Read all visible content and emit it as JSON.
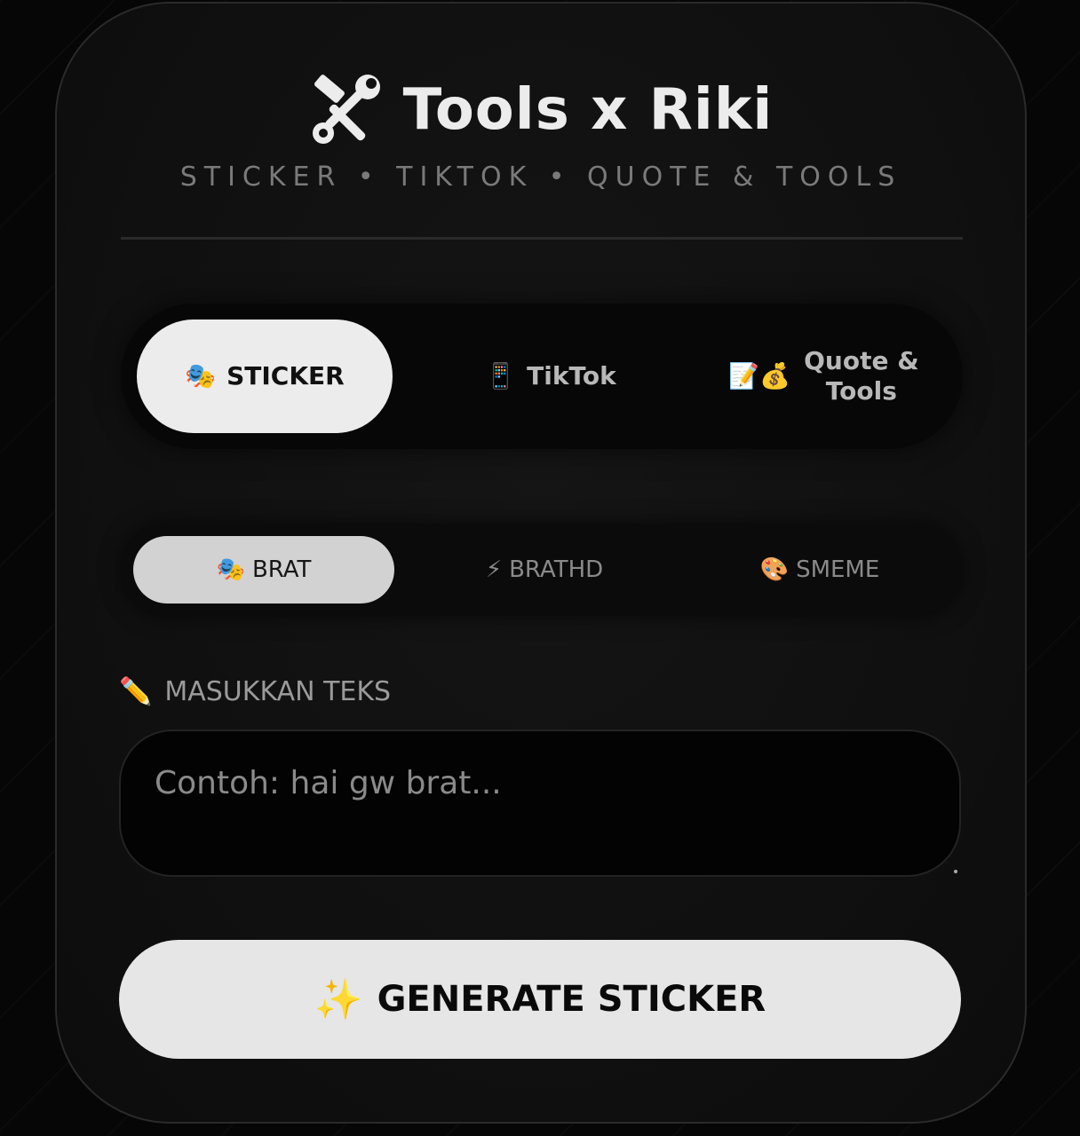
{
  "header": {
    "title": "Tools x Riki",
    "title_icon": "hammer-wrench-icon",
    "subtitle": "STICKER • TIKTOK • QUOTE & TOOLS"
  },
  "tabs": [
    {
      "icon": "🎭",
      "label": "STICKER",
      "active": true
    },
    {
      "icon": "📱",
      "label": "TikTok",
      "active": false
    },
    {
      "icon": "📝💰",
      "label": "Quote & Tools",
      "active": false
    }
  ],
  "subtabs": [
    {
      "icon": "🎭",
      "label": "BRAT",
      "active": true
    },
    {
      "icon": "⚡",
      "label": "BRATHD",
      "active": false
    },
    {
      "icon": "🎨",
      "label": "SMEME",
      "active": false
    }
  ],
  "input": {
    "label_icon": "✏️",
    "label": "MASUKKAN TEKS",
    "placeholder": "Contoh: hai gw brat...",
    "value": ""
  },
  "generate": {
    "icon": "✨",
    "label": "GENERATE STICKER"
  },
  "colors": {
    "background": "#060606",
    "card": "#101010",
    "active_tab": "#ececec",
    "active_subtab": "#d2d2d2",
    "button": "#e6e6e6",
    "accent_spark": "#e8b524"
  }
}
